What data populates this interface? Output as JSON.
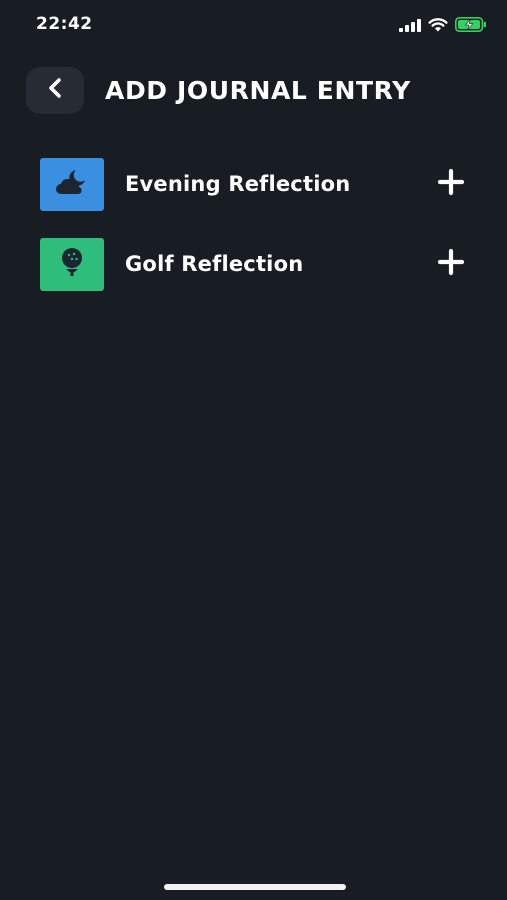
{
  "status_bar": {
    "time": "22:42",
    "icons": [
      "cellular-signal-icon",
      "wifi-icon",
      "battery-charging-icon"
    ]
  },
  "header": {
    "back_icon": "chevron-left-icon",
    "title": "ADD JOURNAL ENTRY"
  },
  "entries": [
    {
      "label": "Evening Reflection",
      "icon": "cloud-moon-icon",
      "icon_bg": "#3b8fe0"
    },
    {
      "label": "Golf Reflection",
      "icon": "golf-ball-icon",
      "icon_bg": "#2ebd7a"
    }
  ],
  "colors": {
    "background": "#181c23",
    "back_button_bg": "#262b34",
    "icon_glyph": "#1c2530",
    "battery": "#33d15f"
  }
}
